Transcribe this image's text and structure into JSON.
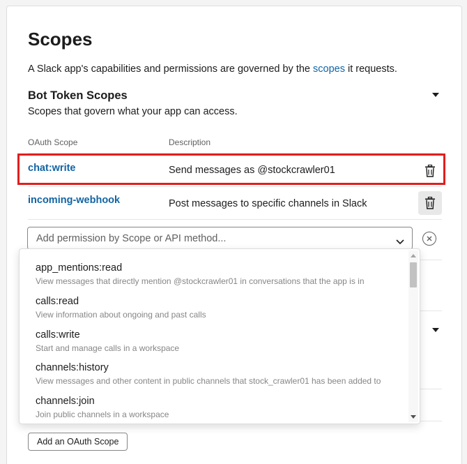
{
  "header": {
    "title": "Scopes",
    "intro_prefix": "A Slack app's capabilities and permissions are governed by the ",
    "intro_link": "scopes",
    "intro_suffix": " it requests."
  },
  "bot_section": {
    "title": "Bot Token Scopes",
    "subtitle": "Scopes that govern what your app can access.",
    "columns": {
      "scope": "OAuth Scope",
      "description": "Description"
    },
    "rows": [
      {
        "scope": "chat:write",
        "description": "Send messages as @stockcrawler01"
      },
      {
        "scope": "incoming-webhook",
        "description": "Post messages to specific channels in Slack"
      }
    ],
    "add_placeholder": "Add permission by Scope or API method...",
    "add_button_label": "Add an OAuth Scope"
  },
  "dropdown": {
    "options": [
      {
        "name": "app_mentions:read",
        "description": "View messages that directly mention @stockcrawler01 in conversations that the app is in"
      },
      {
        "name": "calls:read",
        "description": "View information about ongoing and past calls"
      },
      {
        "name": "calls:write",
        "description": "Start and manage calls in a workspace"
      },
      {
        "name": "channels:history",
        "description": "View messages and other content in public channels that stock_crawler01 has been added to"
      },
      {
        "name": "channels:join",
        "description": "Join public channels in a workspace"
      }
    ]
  },
  "colors": {
    "link": "#1264a3",
    "highlight_border": "#e01e1e",
    "text_primary": "#1d1c1d",
    "text_secondary": "#616061"
  },
  "icons": {
    "section_toggle": "caret-down-icon",
    "delete": "trash-icon",
    "clear": "close-circle-icon",
    "expand": "chevron-down-icon"
  }
}
